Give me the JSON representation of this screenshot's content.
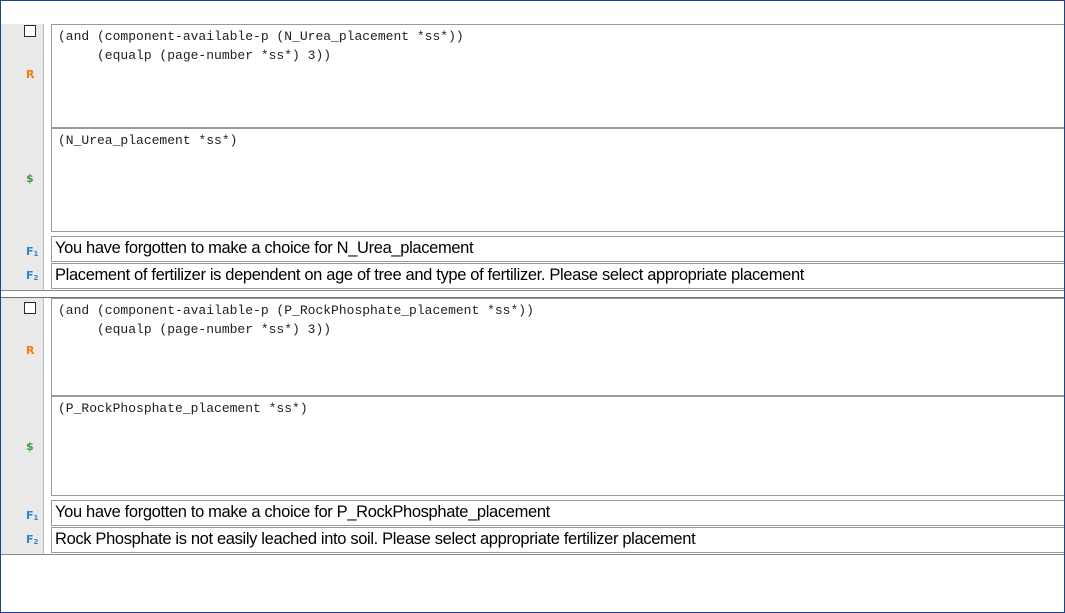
{
  "rules": [
    {
      "condition_marker": "R",
      "condition_lines": [
        "(and (component-available-p (N_Urea_placement *ss*))",
        "     (equalp (page-number *ss*) 3))"
      ],
      "action_marker": "$",
      "action_lines": [
        "(N_Urea_placement *ss*)"
      ],
      "feedback": [
        {
          "marker": "F",
          "sub": "1",
          "text": "You have forgotten to make a choice for N_Urea_placement"
        },
        {
          "marker": "F",
          "sub": "2",
          "text": "Placement of fertilizer is dependent on age of tree and type of fertilizer. Please select appropriate placement"
        }
      ]
    },
    {
      "condition_marker": "R",
      "condition_lines": [
        "(and (component-available-p (P_RockPhosphate_placement *ss*))",
        "     (equalp (page-number *ss*) 3))"
      ],
      "action_marker": "$",
      "action_lines": [
        "(P_RockPhosphate_placement *ss*)"
      ],
      "feedback": [
        {
          "marker": "F",
          "sub": "1",
          "text": "You have forgotten to make a choice for P_RockPhosphate_placement"
        },
        {
          "marker": "F",
          "sub": "2",
          "text": "Rock Phosphate is not easily leached into soil. Please select appropriate fertilizer placement"
        }
      ]
    }
  ],
  "colors": {
    "condition_marker": "#f07c10",
    "action_marker": "#3f9c3f",
    "feedback_marker": "#2a86d8",
    "frame_border": "#1f3f8f"
  }
}
